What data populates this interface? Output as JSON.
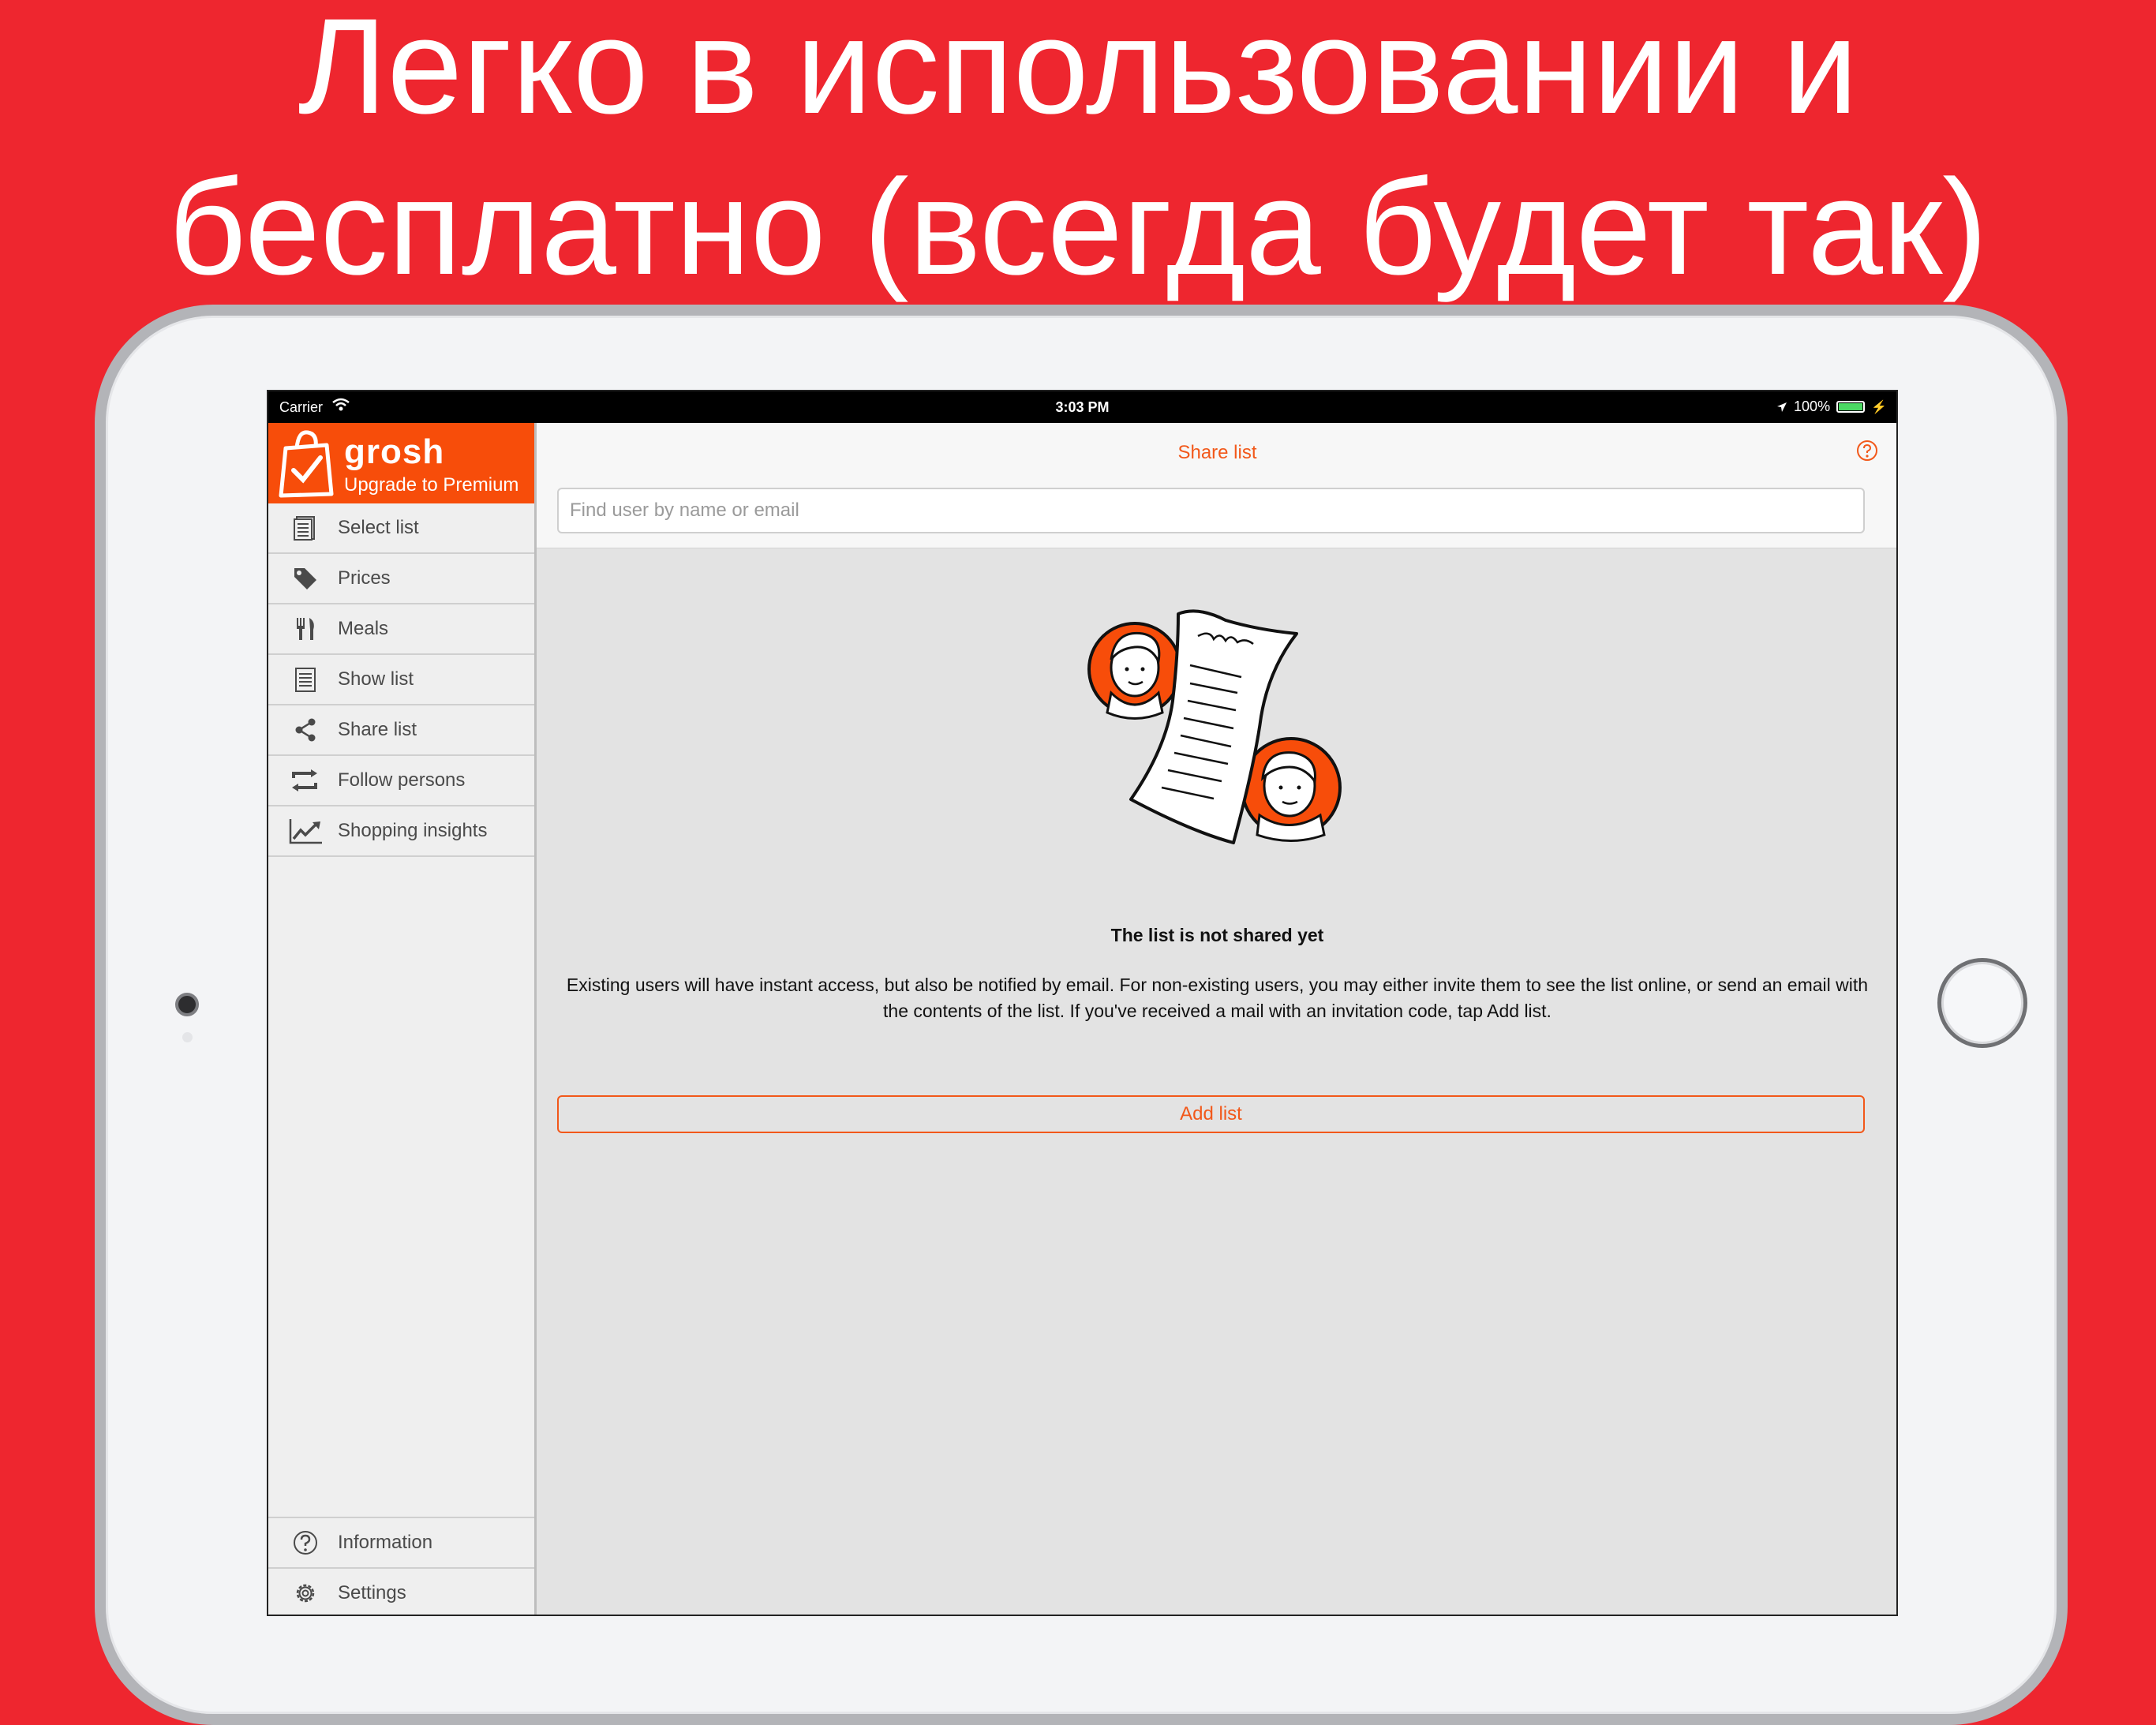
{
  "headline": {
    "line1": "Легко в использовании и",
    "line2": "бесплатно (всегда будет так)"
  },
  "status_bar": {
    "carrier": "Carrier",
    "time": "3:03 PM",
    "battery": "100%",
    "battery_level": 1.0
  },
  "sidebar": {
    "brand_name": "grosh",
    "upgrade": "Upgrade to Premium",
    "items": [
      {
        "label": "Select list",
        "icon": "list-document-icon"
      },
      {
        "label": "Prices",
        "icon": "price-tag-icon"
      },
      {
        "label": "Meals",
        "icon": "fork-knife-icon"
      },
      {
        "label": "Show list",
        "icon": "list-document-icon"
      },
      {
        "label": "Share list",
        "icon": "share-icon"
      },
      {
        "label": "Follow persons",
        "icon": "repeat-arrows-icon"
      },
      {
        "label": "Shopping insights",
        "icon": "trend-chart-icon"
      }
    ],
    "bottom_items": [
      {
        "label": "Information",
        "icon": "question-icon"
      },
      {
        "label": "Settings",
        "icon": "gear-icon"
      }
    ]
  },
  "main": {
    "title": "Share list",
    "search_placeholder": "Find user by name or email",
    "empty_title": "The list is not shared yet",
    "empty_description": "Existing users will have instant access, but also be notified by email. For non-existing users, you may either invite them to see the list online, or send an email with the contents of the list. If you've received a mail with an invitation code, tap Add list.",
    "add_list_label": "Add list"
  },
  "colors": {
    "background_red": "#ee262f",
    "brand_orange": "#f74d0a",
    "accent_orange": "#f2581a"
  }
}
